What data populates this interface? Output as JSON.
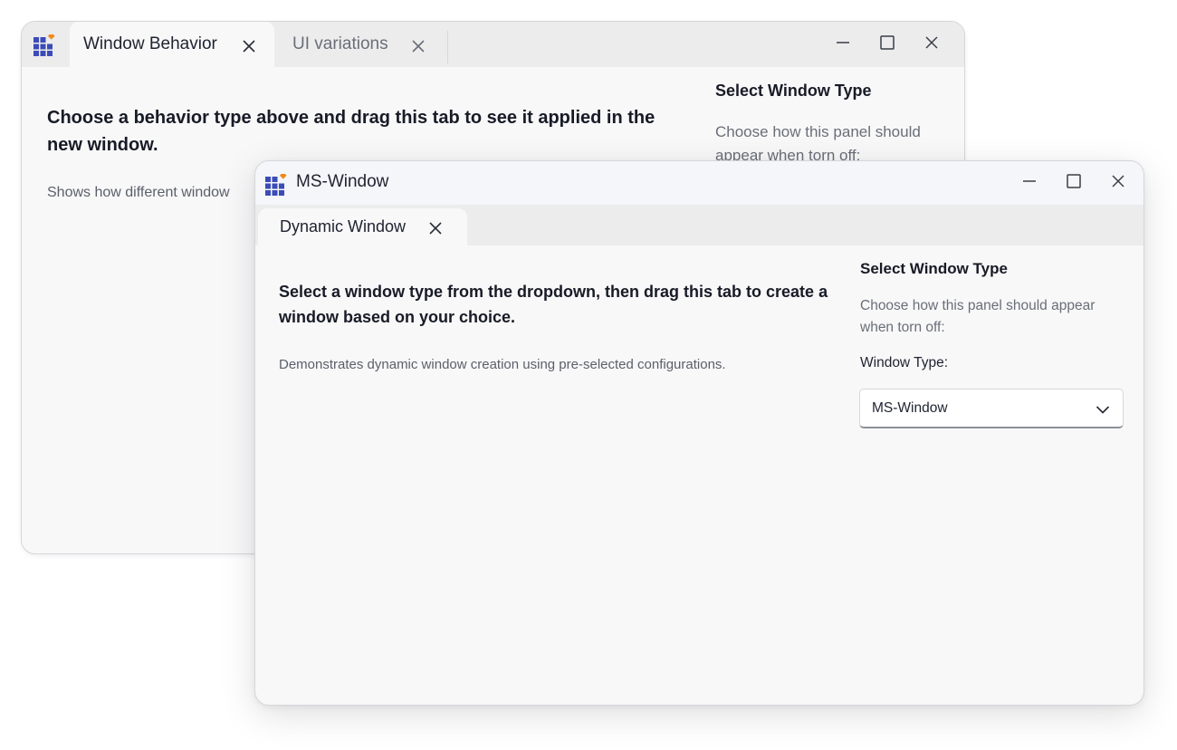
{
  "back_window": {
    "tabs": [
      {
        "label": "Window Behavior",
        "active": true
      },
      {
        "label": "UI variations",
        "active": false
      }
    ],
    "body": {
      "title": "Choose a behavior type above and drag this tab to see it applied in the new window.",
      "description": "Shows how different window"
    },
    "side_panel": {
      "title": "Select Window Type",
      "description": "Choose how this panel should appear when torn off:"
    }
  },
  "front_window": {
    "title": "MS-Window",
    "tabs": [
      {
        "label": "Dynamic Window",
        "active": true
      }
    ],
    "body": {
      "title": "Select a window type from the dropdown, then drag this tab to create a window based on your choice.",
      "description": "Demonstrates dynamic window creation using pre-selected configurations."
    },
    "side_panel": {
      "title": "Select Window Type",
      "description": "Choose how this panel should appear when torn off:",
      "field_label": "Window Type:",
      "selected_value": "MS-Window"
    }
  },
  "icons": {
    "app_logo": "grid-logo-icon",
    "minimize": "minimize-icon",
    "maximize": "maximize-icon",
    "close": "close-icon",
    "tab_close": "close-icon",
    "dropdown": "chevron-down-icon"
  },
  "colors": {
    "logo_grid": "#3b4cb8",
    "logo_accent": "#f08a1c",
    "window_bg": "#f8f8f9",
    "tabstrip_bg": "#ececed"
  }
}
